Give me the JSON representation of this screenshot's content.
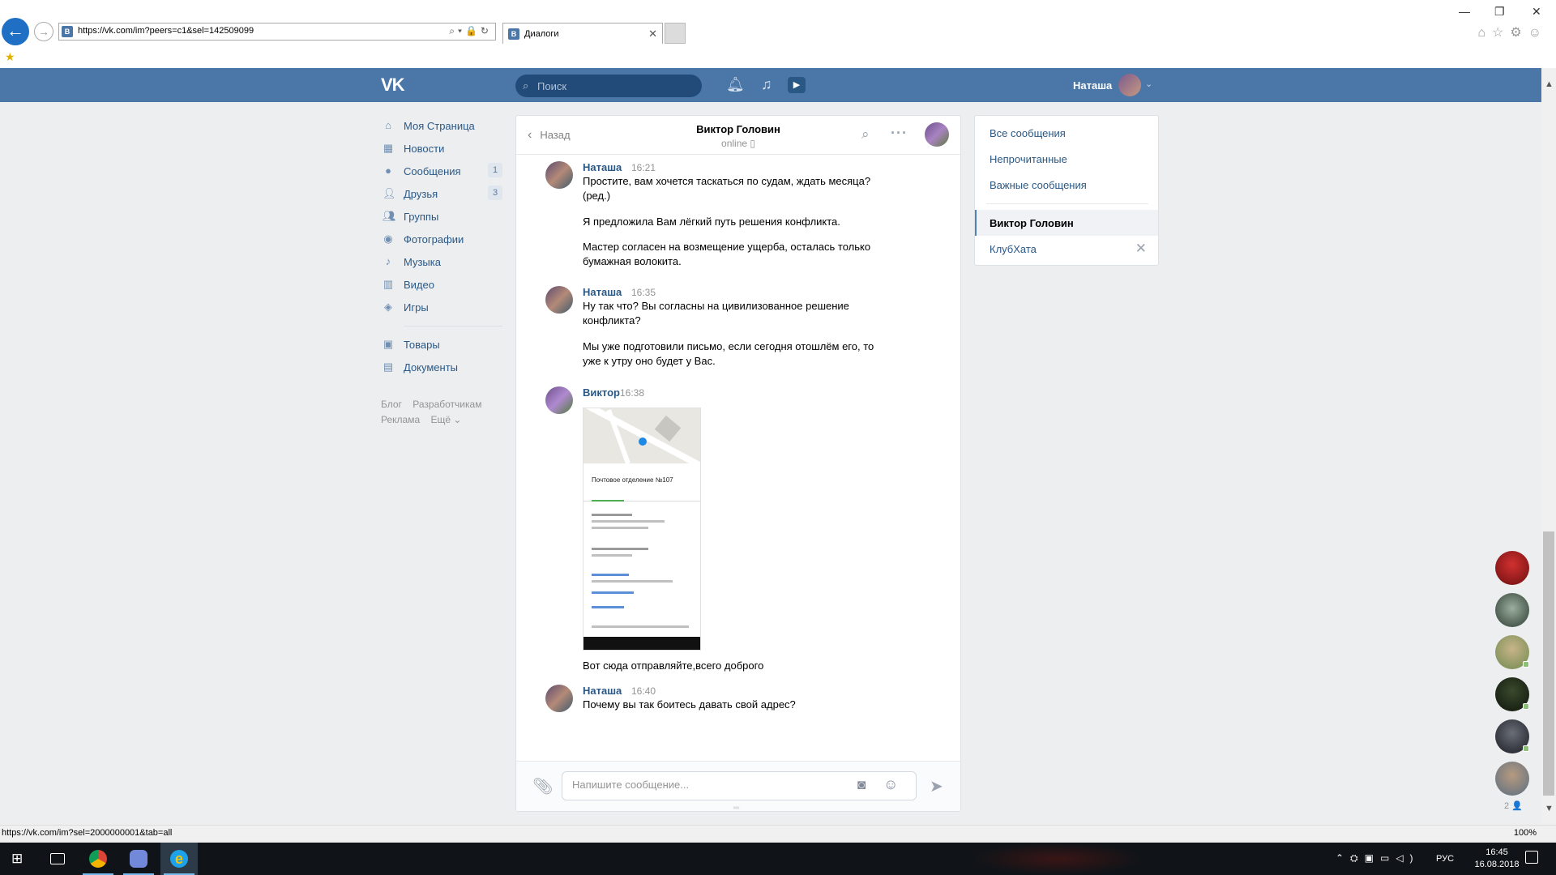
{
  "browser": {
    "url": "https://vk.com/im?peers=c1&sel=142509099",
    "tab_title": "Диалоги",
    "status_url": "https://vk.com/im?sel=2000000001&tab=all",
    "zoom": "100%"
  },
  "header": {
    "logo": "VK",
    "search_placeholder": "Поиск",
    "user_name": "Наташа"
  },
  "left_menu": {
    "items": [
      {
        "label": "Моя Страница"
      },
      {
        "label": "Новости"
      },
      {
        "label": "Сообщения",
        "count": "1"
      },
      {
        "label": "Друзья",
        "count": "3"
      },
      {
        "label": "Группы"
      },
      {
        "label": "Фотографии"
      },
      {
        "label": "Музыка"
      },
      {
        "label": "Видео"
      },
      {
        "label": "Игры"
      }
    ],
    "items2": [
      {
        "label": "Товары"
      },
      {
        "label": "Документы"
      }
    ],
    "footer": [
      "Блог",
      "Разработчикам",
      "Реклама",
      "Ещё ⌄"
    ]
  },
  "chat": {
    "back_label": "Назад",
    "peer_name": "Виктор Головин",
    "peer_status": "online ▯",
    "messages": [
      {
        "author": "Наташа",
        "time": "16:21",
        "texts": [
          "Простите, вам хочется таскаться по судам, ждать месяца?",
          "(ред.)",
          "Я предложила Вам лёгкий путь решения конфликта.",
          "Мастер согласен на возмещение ущерба, осталась только бумажная волокита."
        ]
      },
      {
        "author": "Наташа",
        "time": "16:35",
        "texts": [
          "Ну так что? Вы согласны на цивилизованное решение конфликта?",
          "Мы уже подготовили письмо, если сегодня отошлём его, то уже к утру оно будет у Вас."
        ]
      },
      {
        "author": "Виктор",
        "time": "16:38",
        "image_title": "Почтовое отделение №107",
        "texts": [
          "Вот сюда отправляйте,всего доброго"
        ]
      },
      {
        "author": "Наташа",
        "time": "16:40",
        "texts": [
          "Почему вы так боитесь давать свой адрес?"
        ]
      }
    ],
    "composer_placeholder": "Напишите сообщение..."
  },
  "right_panel": {
    "filters": [
      "Все сообщения",
      "Непрочитанные",
      "Важные сообщения"
    ],
    "active_dialog": "Виктор Головин",
    "second_dialog": "КлубХата"
  },
  "chat_bubbles": {
    "count_label": "2 👤"
  },
  "taskbar": {
    "language": "РУС",
    "time": "16:45",
    "date": "16.08.2018"
  },
  "colors": {
    "vk_blue": "#4a76a8",
    "link": "#2a5885",
    "online": "#8ac176"
  }
}
